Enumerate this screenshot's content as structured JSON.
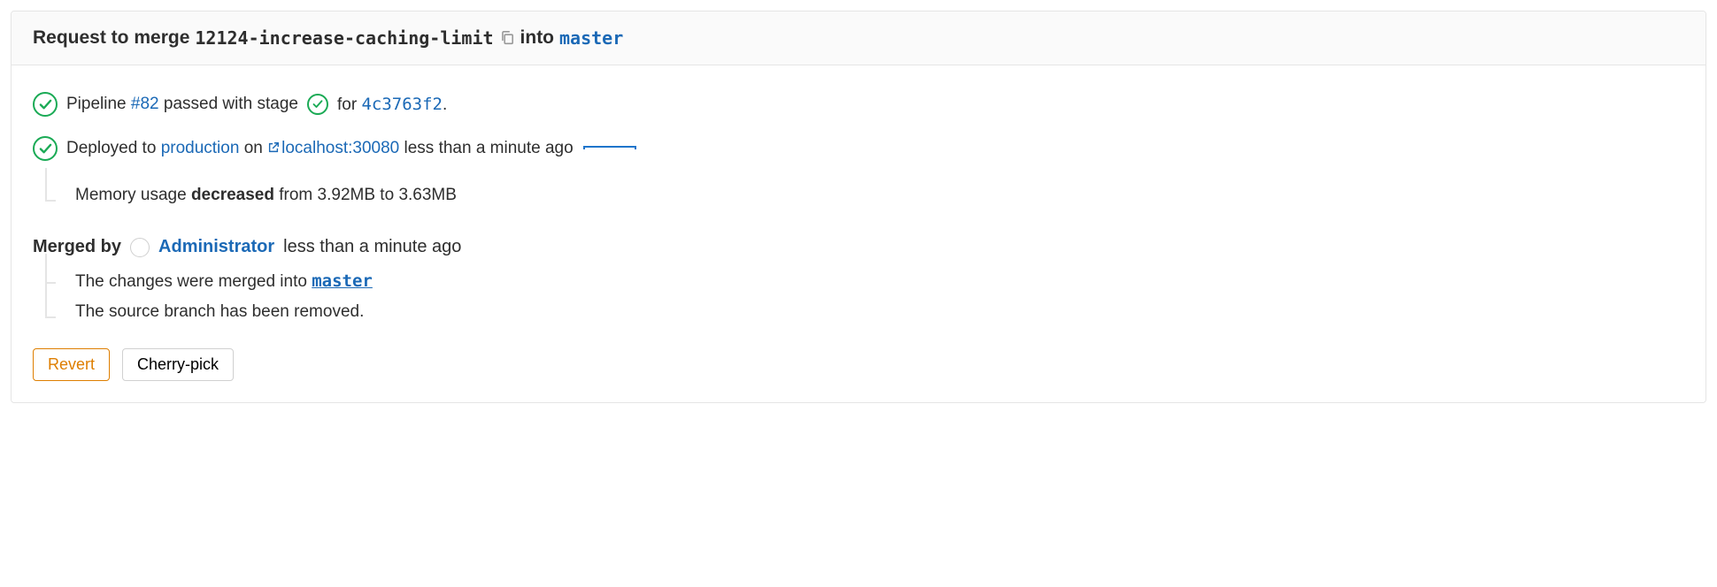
{
  "header": {
    "prefix": "Request to merge",
    "source_branch": "12124-increase-caching-limit",
    "into": "into",
    "target_branch": "master"
  },
  "pipeline": {
    "text_pipeline": "Pipeline",
    "number": "#82",
    "text_passed": "passed with stage",
    "text_for": "for",
    "commit": "4c3763f2",
    "period": "."
  },
  "deploy": {
    "text_deployed_to": "Deployed to",
    "env": "production",
    "text_on": "on",
    "url": "localhost:30080",
    "time": "less than a minute ago"
  },
  "memory": {
    "label": "Memory usage",
    "change": "decreased",
    "from_text": "from",
    "from": "3.92MB",
    "to_text": "to",
    "to": "3.63MB"
  },
  "merged": {
    "label": "Merged by",
    "user": "Administrator",
    "time": "less than a minute ago",
    "changes_text_before": "The changes were merged into",
    "target_branch": "master",
    "source_removed": "The source branch has been removed."
  },
  "actions": {
    "revert": "Revert",
    "cherry_pick": "Cherry-pick"
  }
}
